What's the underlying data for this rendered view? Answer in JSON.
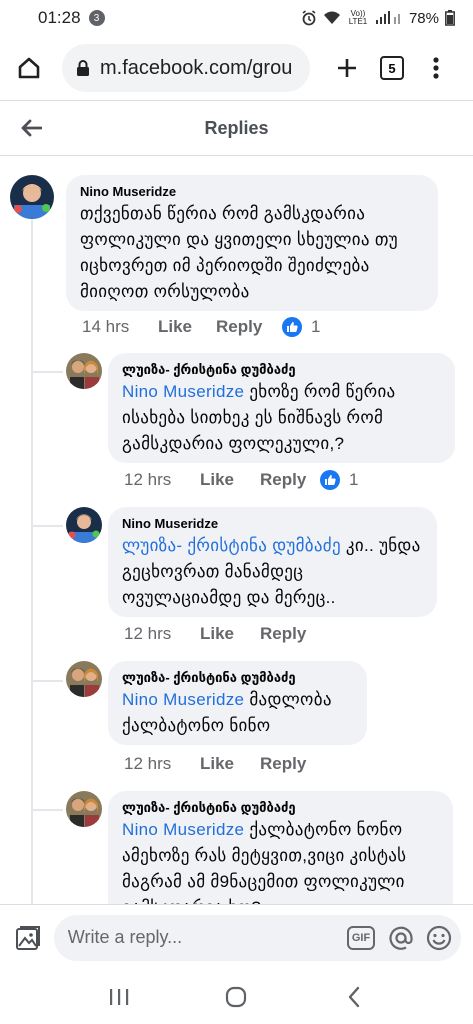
{
  "status_bar": {
    "time": "01:28",
    "notification_count": "3",
    "lte_label": "Vo)) LTE1",
    "battery": "78%"
  },
  "browser": {
    "url": "m.facebook.com/grou",
    "tab_count": "5"
  },
  "header": {
    "title": "Replies"
  },
  "comments": [
    {
      "author": "Nino Museridze",
      "mention": "",
      "text": "თქვენთან წერია რომ გამსკდარია ფოლიკული და ყვითელი სხეულია თუ იცხოვრეთ იმ პერიოდში შეიძლება მიიღოთ ორსულობა",
      "time": "14 hrs",
      "like_label": "Like",
      "reply_label": "Reply",
      "reaction_count": "1"
    },
    {
      "author": "ლუიზა- ქრისტინა დუმბაძე",
      "mention": "Nino Museridze",
      "text": " ეხოზე რომ წერია ისახება სითხეკ ეს ნიშნავს რომ გამსკდარია ფოლეკული,?",
      "time": "12 hrs",
      "like_label": "Like",
      "reply_label": "Reply",
      "reaction_count": "1"
    },
    {
      "author": "Nino Museridze",
      "mention": "ლუიზა- ქრისტინა დუმბაძე",
      "text": " კი.. უნდა გეცხოვრათ მანამდეც ოვულაციამდე და მერეც..",
      "time": "12 hrs",
      "like_label": "Like",
      "reply_label": "Reply",
      "reaction_count": ""
    },
    {
      "author": "ლუიზა- ქრისტინა დუმბაძე",
      "mention": "Nino Museridze",
      "text": " მადლობა ქალბატონო ნინო",
      "time": "12 hrs",
      "like_label": "Like",
      "reply_label": "Reply",
      "reaction_count": ""
    },
    {
      "author": "ლუიზა- ქრისტინა დუმბაძე",
      "mention": "Nino Museridze",
      "text": " ქალბატონო ნონო ამეხოზე რას მეტყვით,ვიცი კისტას მაგრამ ამ მ9ნაცემით ფოლიკული გამსკდარია ხო?",
      "time": "",
      "like_label": "",
      "reply_label": "",
      "reaction_count": ""
    }
  ],
  "composer": {
    "placeholder": "Write a reply...",
    "gif_label": "GIF"
  },
  "colors": {
    "link": "#216fdb",
    "bubble": "#f0f2f5",
    "like_blue": "#1877f2",
    "meta": "#65676b"
  },
  "icons": [
    "home-icon",
    "lock-icon",
    "plus-icon",
    "more-vert-icon",
    "back-arrow-icon",
    "thumbs-up-icon",
    "photo-icon",
    "at-icon",
    "emoji-icon",
    "recents-icon",
    "home-circle-icon",
    "back-chevron-icon"
  ]
}
